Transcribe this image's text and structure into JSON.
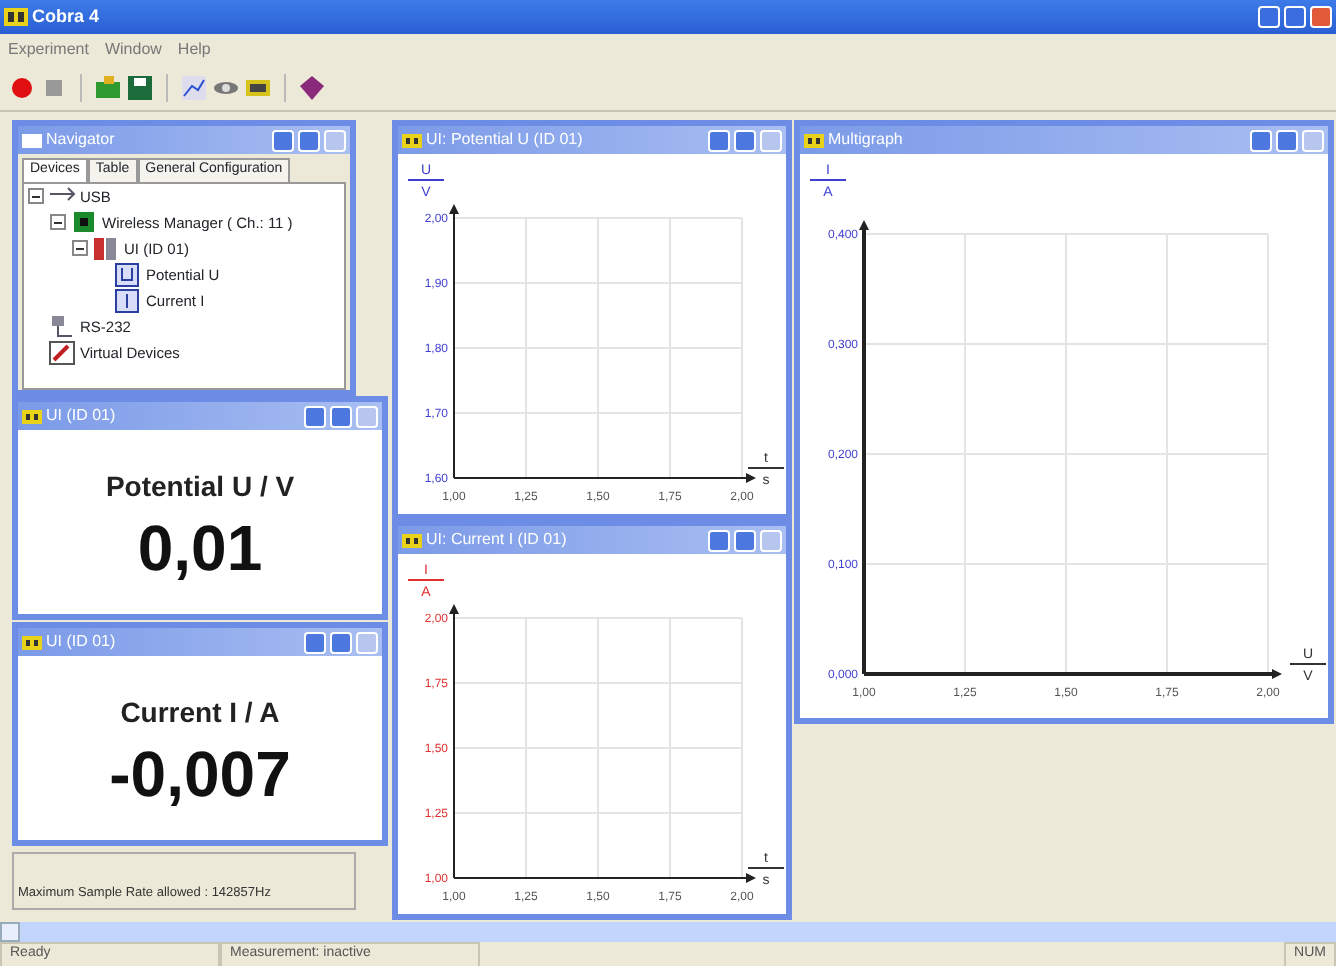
{
  "window": {
    "title": "Cobra 4"
  },
  "menu": [
    "Experiment",
    "Window",
    "Help"
  ],
  "toolbar": [
    {
      "kind": "record"
    },
    {
      "kind": "stop"
    },
    {
      "kind": "sep"
    },
    {
      "kind": "open"
    },
    {
      "kind": "save"
    },
    {
      "kind": "sep"
    },
    {
      "kind": "chart"
    },
    {
      "kind": "link"
    },
    {
      "kind": "display"
    },
    {
      "kind": "sep"
    },
    {
      "kind": "gem"
    }
  ],
  "navigator": {
    "title": "Navigator",
    "tabs": [
      {
        "label": "Devices",
        "selected": true
      },
      {
        "label": "Table",
        "selected": false
      },
      {
        "label": "General Configuration",
        "selected": false
      }
    ],
    "tree": [
      {
        "label": "USB",
        "kind": "usb",
        "expanded": true,
        "children": [
          {
            "label": "Wireless Manager ( Ch.: 11 )",
            "kind": "wireless",
            "expanded": true,
            "children": [
              {
                "label": "UI (ID 01)",
                "kind": "device",
                "expanded": true,
                "children": [
                  {
                    "label": "Potential U",
                    "kind": "sensor_u"
                  },
                  {
                    "label": "Current I",
                    "kind": "sensor_i"
                  }
                ]
              }
            ]
          }
        ]
      },
      {
        "label": "RS-232",
        "kind": "serial"
      },
      {
        "label": "Virtual Devices",
        "kind": "virtual"
      }
    ]
  },
  "displays": [
    {
      "title": "UI (ID 01)",
      "quantity": "Potential U / V",
      "value": "0,01"
    },
    {
      "title": "UI (ID 01)",
      "quantity": "Current I / A",
      "value": "-0,007"
    }
  ],
  "graphs": [
    {
      "title": "UI: Potential U (ID 01)",
      "y_axis": {
        "symbol": "U",
        "unit": "V"
      },
      "x_axis": {
        "symbol": "t",
        "unit": "s"
      },
      "chart_data": {
        "type": "line",
        "grid": true,
        "xlim": [
          1.0,
          2.0
        ],
        "ylim": [
          1.6,
          2.0
        ],
        "xticks": [
          {
            "value": 1.0,
            "label": "1,00"
          },
          {
            "value": 1.25,
            "label": "1,25"
          },
          {
            "value": 1.5,
            "label": "1,50"
          },
          {
            "value": 1.75,
            "label": "1,75"
          },
          {
            "value": 2.0,
            "label": "2,00"
          }
        ],
        "yticks": [
          {
            "value": 1.6,
            "label": "1,60"
          },
          {
            "value": 1.7,
            "label": "1,70"
          },
          {
            "value": 1.8,
            "label": "1,80"
          },
          {
            "value": 1.9,
            "label": "1,90"
          },
          {
            "value": 2.0,
            "label": "2,00"
          }
        ]
      }
    },
    {
      "title": "UI: Current I (ID 01)",
      "y_axis": {
        "symbol": "I",
        "unit": "A"
      },
      "x_axis": {
        "symbol": "t",
        "unit": "s"
      },
      "chart_data": {
        "type": "line",
        "grid": true,
        "xlim": [
          1.0,
          2.0
        ],
        "ylim": [
          1.0,
          2.0
        ],
        "xticks": [
          {
            "value": 1.0,
            "label": "1,00"
          },
          {
            "value": 1.25,
            "label": "1,25"
          },
          {
            "value": 1.5,
            "label": "1,50"
          },
          {
            "value": 1.75,
            "label": "1,75"
          },
          {
            "value": 2.0,
            "label": "2,00"
          }
        ],
        "yticks": [
          {
            "value": 1.0,
            "label": "1,00"
          },
          {
            "value": 1.25,
            "label": "1,25"
          },
          {
            "value": 1.5,
            "label": "1,50"
          },
          {
            "value": 1.75,
            "label": "1,75"
          },
          {
            "value": 2.0,
            "label": "2,00"
          }
        ]
      }
    },
    {
      "title": "Multigraph",
      "y_axis": {
        "symbol": "I",
        "unit": "A"
      },
      "x_axis": {
        "symbol": "U",
        "unit": "V"
      },
      "chart_data": {
        "type": "line",
        "grid": true,
        "xlim": [
          1.0,
          2.0
        ],
        "ylim": [
          0,
          0.4
        ],
        "xticks": [
          {
            "value": 1.0,
            "label": "1,00"
          },
          {
            "value": 1.25,
            "label": "1,25"
          },
          {
            "value": 1.5,
            "label": "1,50"
          },
          {
            "value": 1.75,
            "label": "1,75"
          },
          {
            "value": 2.0,
            "label": "2,00"
          }
        ],
        "yticks": [
          {
            "value": 0,
            "label": "0,000"
          },
          {
            "value": 0.1,
            "label": "0,100"
          },
          {
            "value": 0.2,
            "label": "0,200"
          },
          {
            "value": 0.3,
            "label": "0,300"
          },
          {
            "value": 0.4,
            "label": "0,400"
          }
        ]
      }
    }
  ],
  "info": "Maximum Sample Rate allowed : 142857Hz",
  "status_bar": [
    "Ready",
    "Measurement: inactive",
    "NUM"
  ]
}
